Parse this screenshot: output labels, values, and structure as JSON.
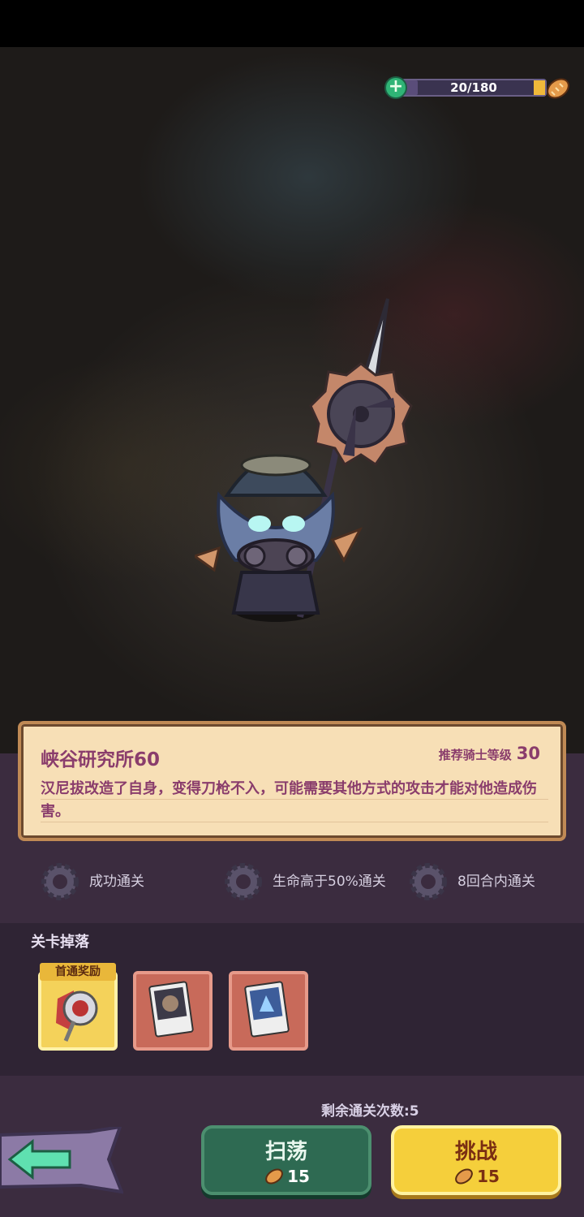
{
  "energy": {
    "value_text": "20/180",
    "fill_fraction": 0.11
  },
  "stage": {
    "title": "峡谷研究所60",
    "recommended_label": "推荐骑士等级",
    "recommended_level": "30",
    "description": "汉尼拔改造了自身，变得刀枪不入，可能需要其他方式的攻击才能对他造成伤害。"
  },
  "goals": [
    {
      "text": "成功通关"
    },
    {
      "text": "生命高于50%通关"
    },
    {
      "text": "8回合内通关"
    }
  ],
  "drops": {
    "label": "关卡掉落",
    "first_clear_badge": "首通奖励"
  },
  "remaining": "剩余通关次数:5",
  "buttons": {
    "sweep_label": "扫荡",
    "sweep_cost": "15",
    "fight_label": "挑战",
    "fight_cost": "15"
  },
  "colors": {
    "accent_text": "#8a3d6c",
    "gold": "#f5cf3b",
    "green": "#2e6a52"
  }
}
